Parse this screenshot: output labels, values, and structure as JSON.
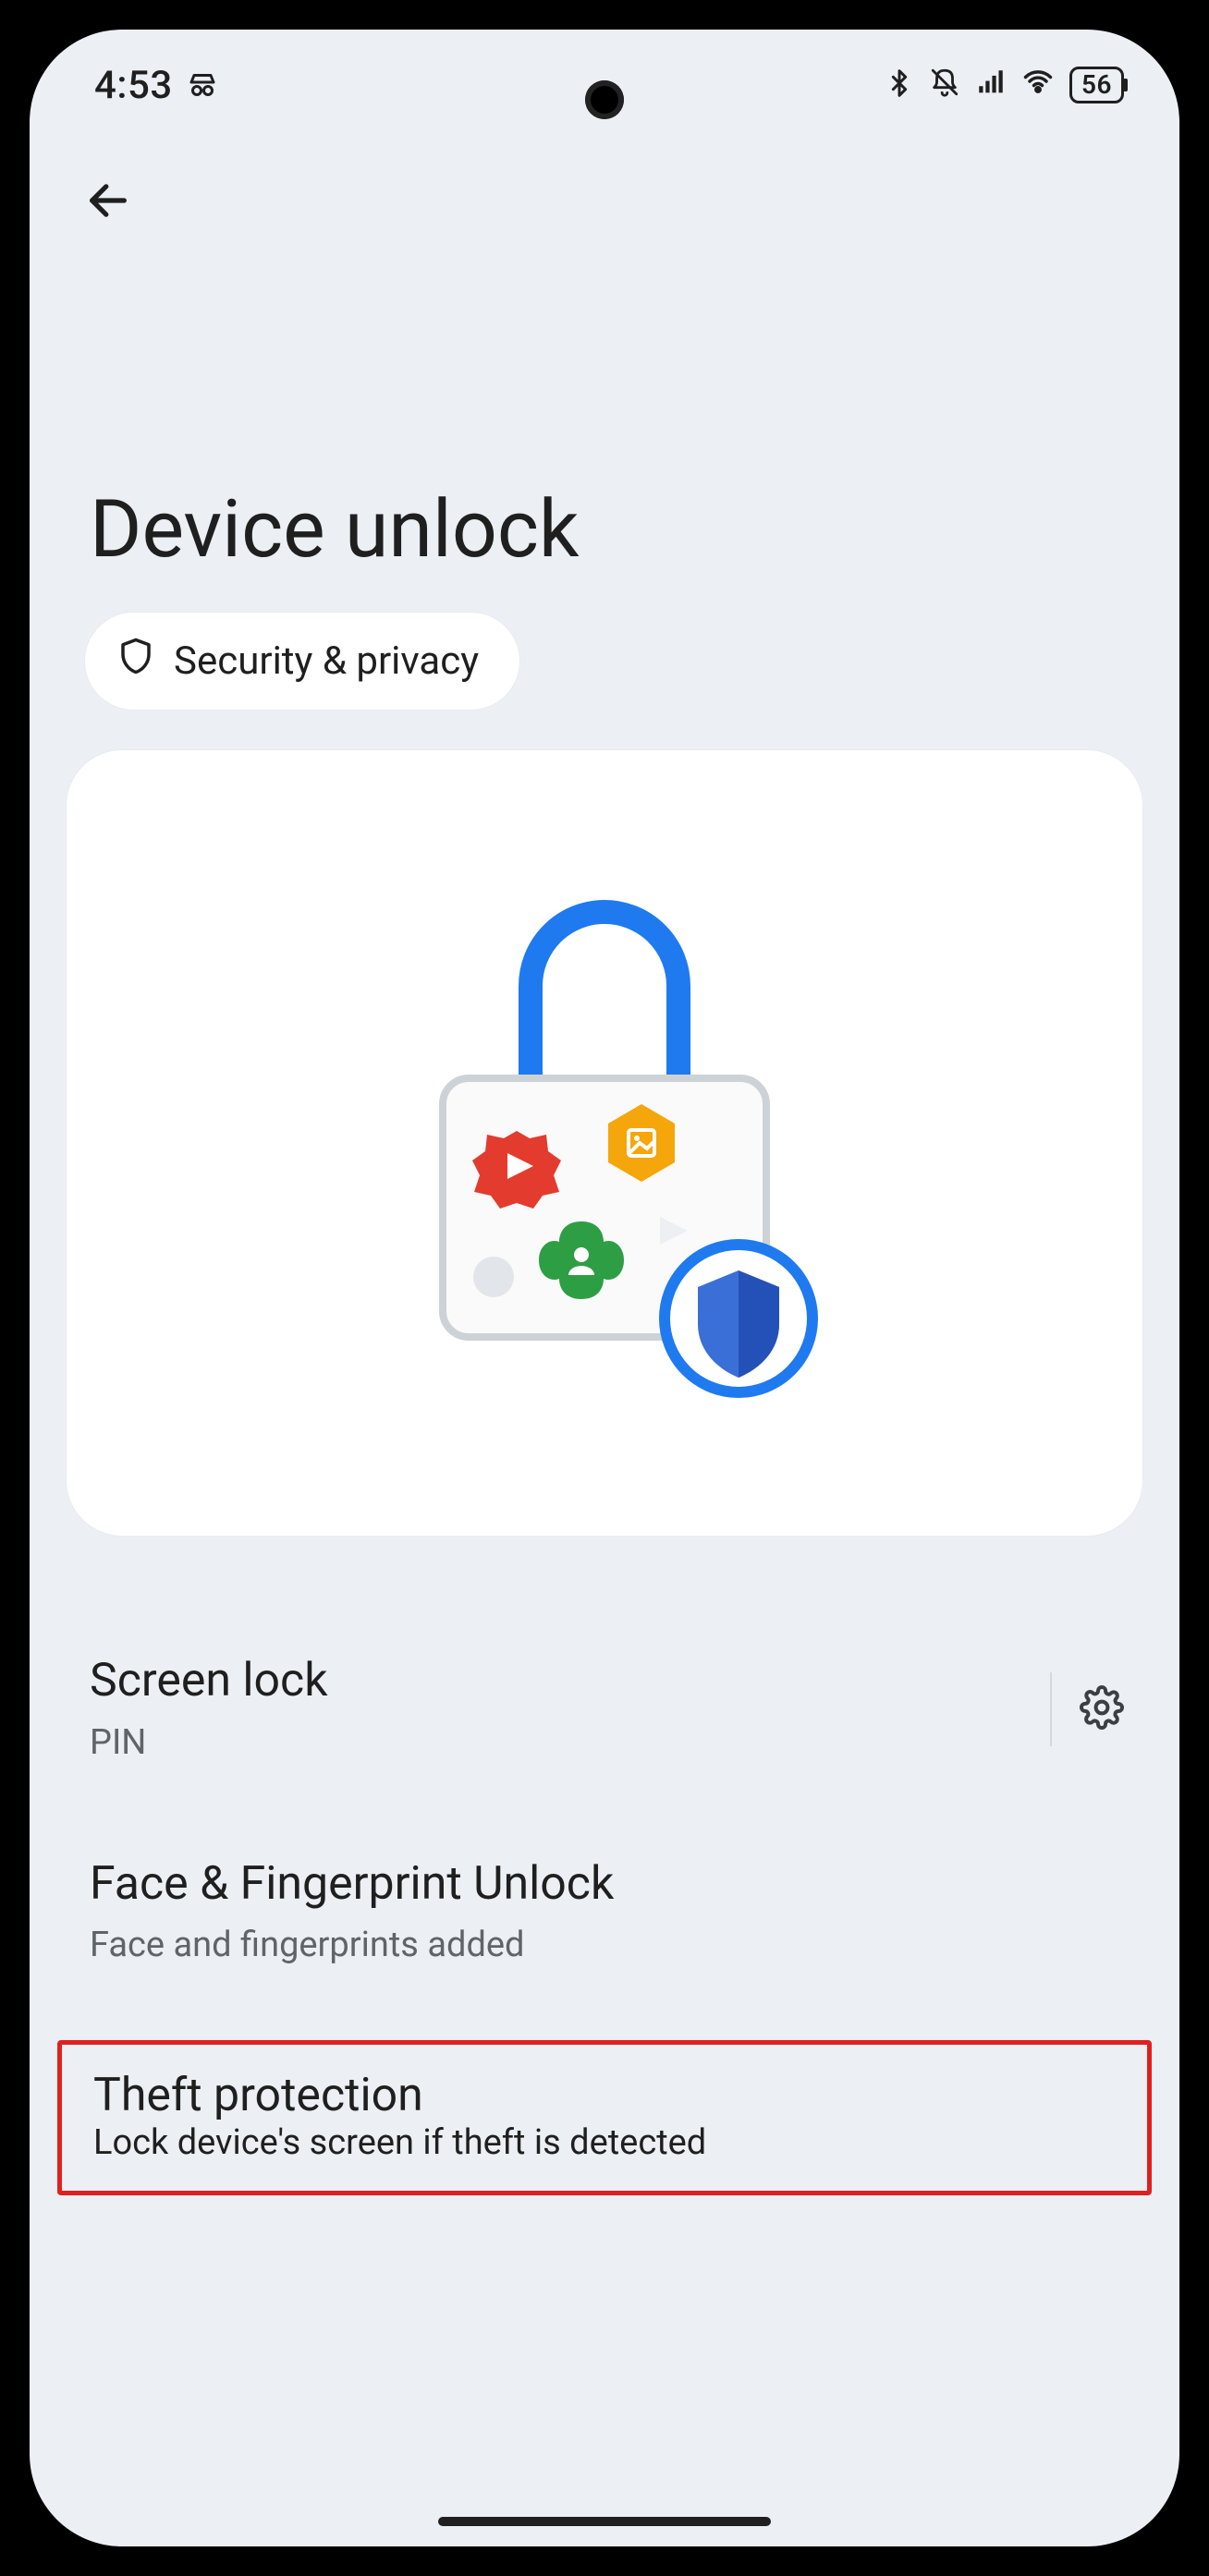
{
  "status": {
    "time": "4:53",
    "battery": "56"
  },
  "page": {
    "title": "Device unlock",
    "chip_label": "Security & privacy"
  },
  "rows": {
    "screen_lock": {
      "label": "Screen lock",
      "sub": "PIN"
    },
    "biometrics": {
      "label": "Face & Fingerprint Unlock",
      "sub": "Face and fingerprints added"
    },
    "theft": {
      "label": "Theft protection",
      "sub": "Lock device's screen if theft is detected"
    }
  }
}
